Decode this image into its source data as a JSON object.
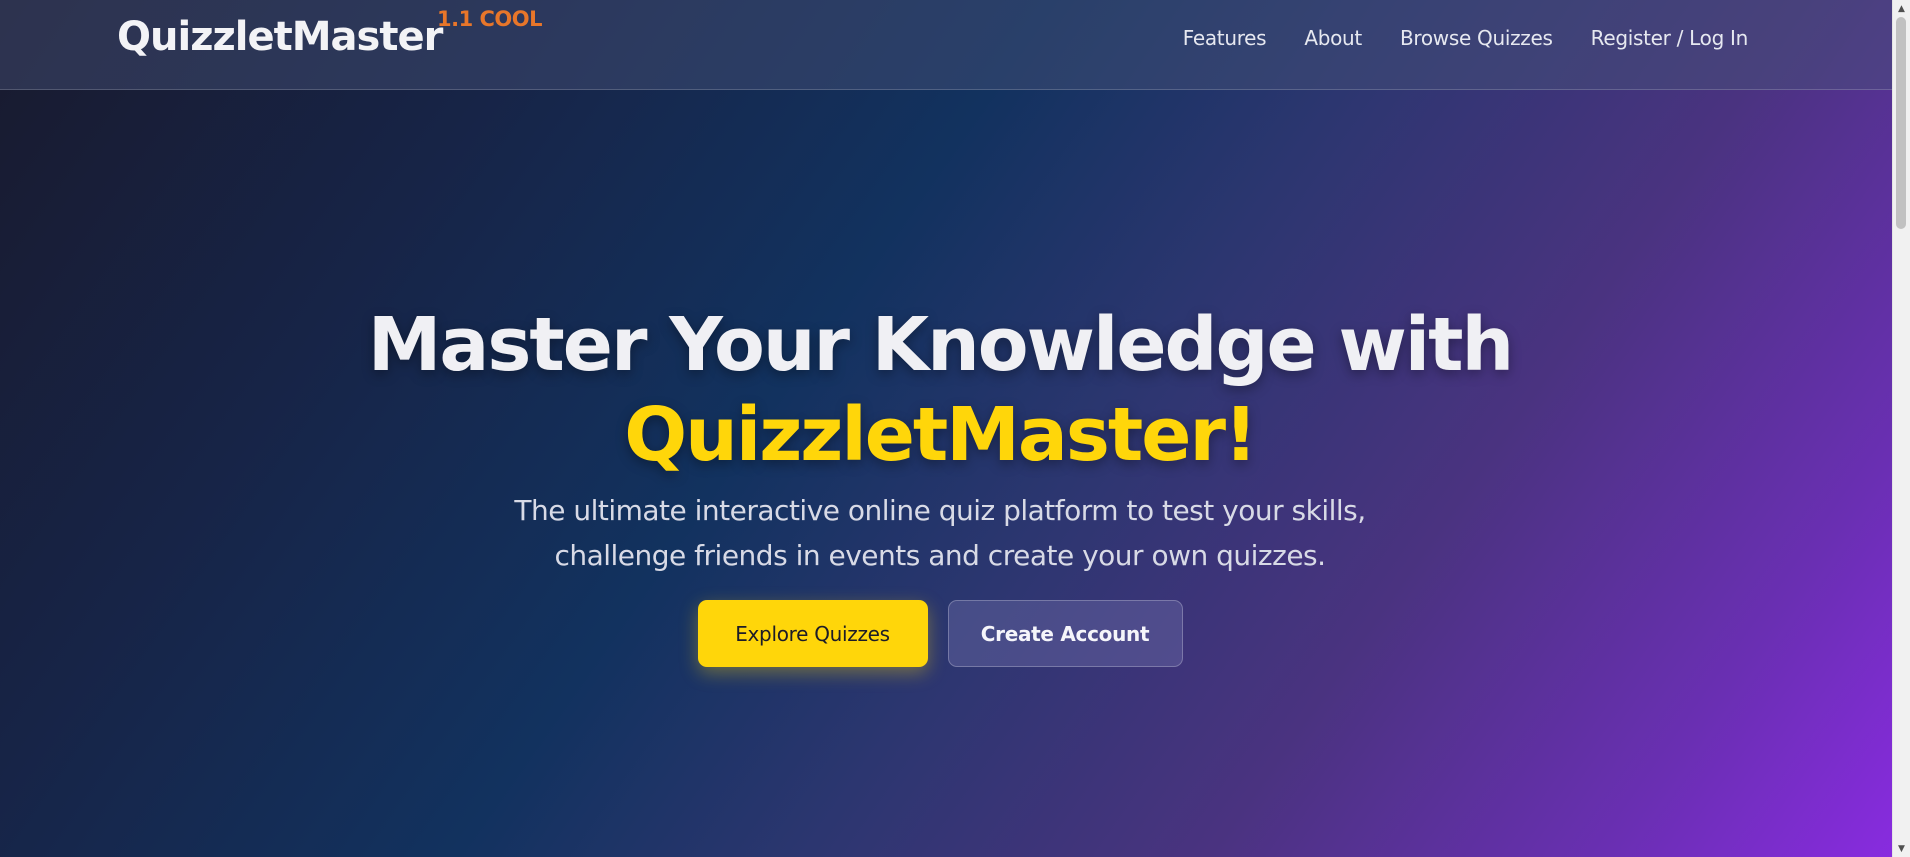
{
  "header": {
    "brand": "QuizzletMaster",
    "version_badge": "1.1 COOL",
    "nav": [
      {
        "label": "Features"
      },
      {
        "label": "About"
      },
      {
        "label": "Browse Quizzes"
      },
      {
        "label": "Register / Log In"
      }
    ]
  },
  "hero": {
    "title_line1": "Master Your Knowledge with",
    "title_line2": "QuizzletMaster!",
    "subtitle_line1": "The ultimate interactive online quiz platform to test your skills,",
    "subtitle_line2": "challenge friends in events and create your own quizzes.",
    "primary_button": "Explore Quizzes",
    "secondary_button": "Create Account"
  },
  "scrollbar": {
    "up_icon": "▲",
    "down_icon": "▼"
  },
  "colors": {
    "accent": "#ffd60a",
    "version_badge": "#e8762a",
    "gradient_start": "#181a2e",
    "gradient_end": "#8a2be2"
  }
}
